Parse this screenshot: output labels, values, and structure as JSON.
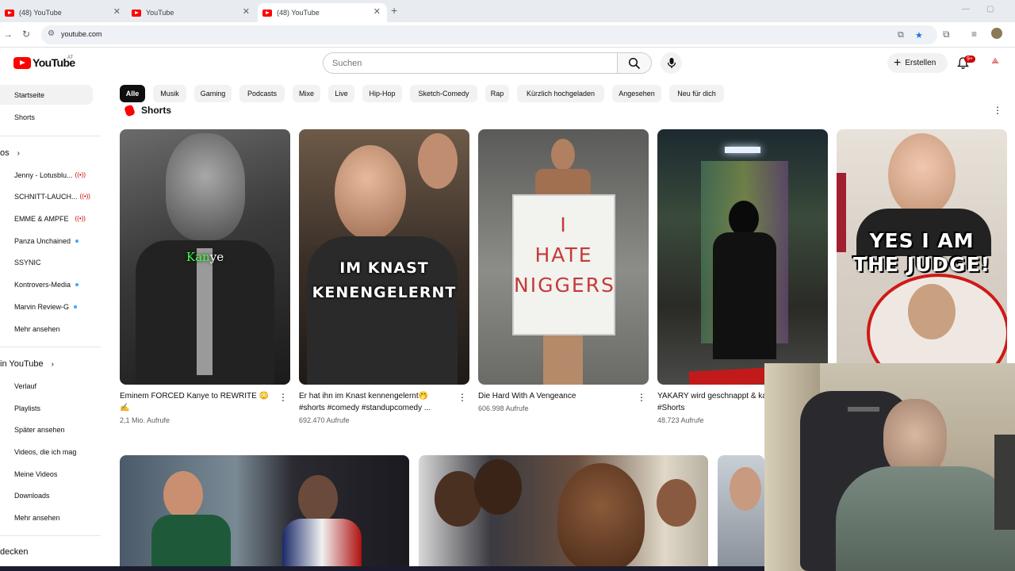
{
  "browser": {
    "tabs": [
      {
        "title": "(48) YouTube"
      },
      {
        "title": "YouTube"
      },
      {
        "title": "(48) YouTube"
      }
    ],
    "new_tab_label": "+",
    "url": "youtube.com"
  },
  "masthead": {
    "logo_text": "YouTube",
    "country": "AT",
    "search_placeholder": "Suchen",
    "create_label": "Erstellen",
    "notification_count": "9+"
  },
  "sidebar": {
    "home": "Startseite",
    "shorts": "Shorts",
    "subscriptions_heading": "os",
    "channels": [
      {
        "name": "Jenny - Lotusblu...",
        "status": "live"
      },
      {
        "name": "SCHNITT-LAUCH...",
        "status": "live"
      },
      {
        "name": "EMME & AMPFE",
        "status": "live"
      },
      {
        "name": "Panza Unchained",
        "status": "new"
      },
      {
        "name": "SSYNIC",
        "status": ""
      },
      {
        "name": "Kontrovers-Media",
        "status": "new"
      },
      {
        "name": "Marvin Review-G",
        "status": "new"
      }
    ],
    "show_more": "Mehr ansehen",
    "you_heading": "in YouTube",
    "you_items": [
      "Verlauf",
      "Playlists",
      "Später ansehen",
      "Videos, die ich mag",
      "Meine Videos",
      "Downloads",
      "Mehr ansehen"
    ],
    "explore_heading": "decken"
  },
  "chips": [
    "Alle",
    "Musik",
    "Gaming",
    "Podcasts",
    "Mixe",
    "Live",
    "Hip-Hop",
    "Sketch-Comedy",
    "Rap",
    "Kürzlich hochgeladen",
    "Angesehen",
    "Neu für dich"
  ],
  "shorts": {
    "heading": "Shorts",
    "items": [
      {
        "title": "Eminem FORCED Kanye to REWRITE 😳✍️",
        "views": "2,1 Mio. Aufrufe",
        "overlay_a": "Kan",
        "overlay_b": "ye"
      },
      {
        "title": "Er hat ihn im Knast kennengelernt🤭 #shorts  #comedy #standupcomedy ...",
        "views": "692.470 Aufrufe",
        "overlay_a": "IM KNAST",
        "overlay_b": "KENENGELERNT"
      },
      {
        "title": "Die Hard With A Vengeance",
        "views": "606.998 Aufrufe",
        "overlay_a": "I",
        "overlay_b": "HATE",
        "overlay_c": "NIGGERS"
      },
      {
        "title": "YAKARY wird geschnappt & kassiert! #Shorts",
        "views": "48.723 Aufrufe"
      },
      {
        "title": "",
        "views": "",
        "overlay_a": "YES I AM",
        "overlay_b": "THE JUDGE!"
      }
    ]
  },
  "colors": {
    "brand_red": "#ff0000",
    "live_red": "#cc0000",
    "chip_bg": "#f2f2f2",
    "chip_active": "#0f0f0f",
    "meta_gray": "#606060"
  }
}
